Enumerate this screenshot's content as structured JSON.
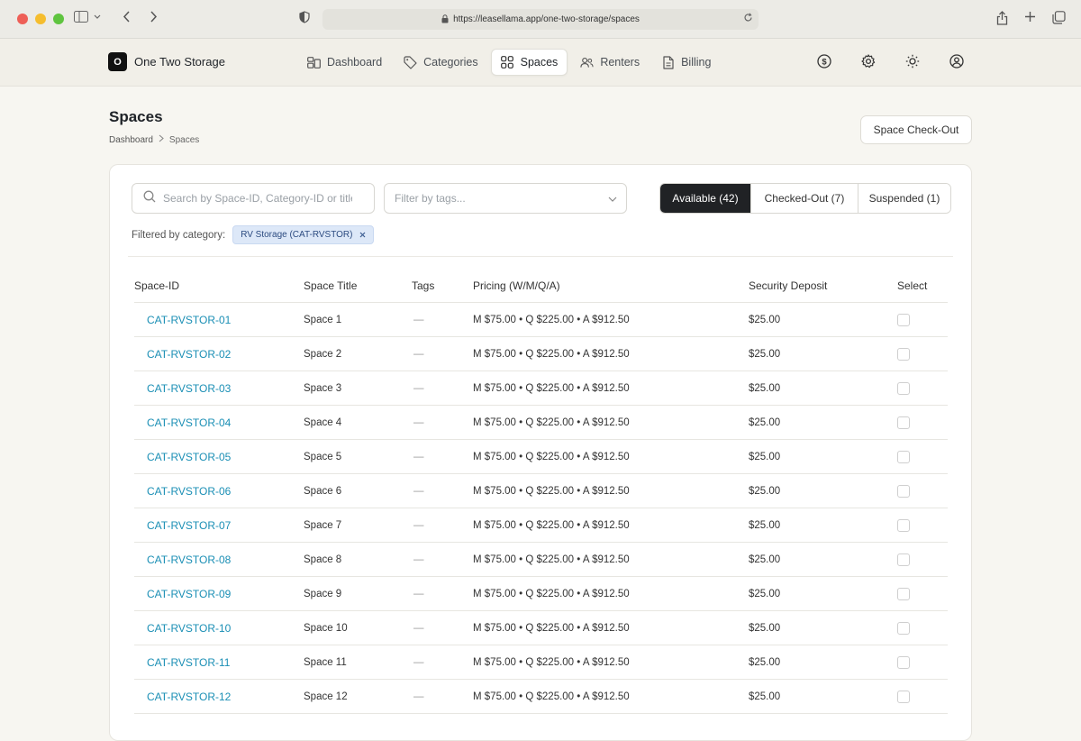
{
  "browser": {
    "url": "https://leasellama.app/one-two-storage/spaces"
  },
  "header": {
    "brand_logo": "O",
    "brand_name": "One Two Storage",
    "nav": [
      {
        "label": "Dashboard",
        "icon": "dashboard-icon",
        "active": false
      },
      {
        "label": "Categories",
        "icon": "tag-icon",
        "active": false
      },
      {
        "label": "Spaces",
        "icon": "grid-icon",
        "active": true
      },
      {
        "label": "Renters",
        "icon": "users-icon",
        "active": false
      },
      {
        "label": "Billing",
        "icon": "document-icon",
        "active": false
      }
    ],
    "right_icons": [
      "dollar-icon",
      "gear-icon",
      "sun-icon",
      "user-circle-icon"
    ]
  },
  "page": {
    "title": "Spaces",
    "breadcrumb": [
      "Dashboard",
      "Spaces"
    ],
    "checkout_label": "Space Check-Out"
  },
  "filters": {
    "search_placeholder": "Search by Space-ID, Category-ID or title",
    "tags_placeholder": "Filter by tags...",
    "segments": [
      {
        "label": "Available (42)",
        "active": true
      },
      {
        "label": "Checked-Out (7)",
        "active": false
      },
      {
        "label": "Suspended (1)",
        "active": false
      }
    ],
    "category_label": "Filtered by category:",
    "category_chip": "RV Storage (CAT-RVSTOR)"
  },
  "table": {
    "columns": [
      "Space-ID",
      "Space Title",
      "Tags",
      "Pricing (W/M/Q/A)",
      "Security Deposit",
      "Select"
    ],
    "rows": [
      {
        "id": "CAT-RVSTOR-01",
        "title": "Space 1",
        "tags": "—",
        "pricing": "M $75.00 • Q $225.00 • A $912.50",
        "deposit": "$25.00"
      },
      {
        "id": "CAT-RVSTOR-02",
        "title": "Space 2",
        "tags": "—",
        "pricing": "M $75.00 • Q $225.00 • A $912.50",
        "deposit": "$25.00"
      },
      {
        "id": "CAT-RVSTOR-03",
        "title": "Space 3",
        "tags": "—",
        "pricing": "M $75.00 • Q $225.00 • A $912.50",
        "deposit": "$25.00"
      },
      {
        "id": "CAT-RVSTOR-04",
        "title": "Space 4",
        "tags": "—",
        "pricing": "M $75.00 • Q $225.00 • A $912.50",
        "deposit": "$25.00"
      },
      {
        "id": "CAT-RVSTOR-05",
        "title": "Space 5",
        "tags": "—",
        "pricing": "M $75.00 • Q $225.00 • A $912.50",
        "deposit": "$25.00"
      },
      {
        "id": "CAT-RVSTOR-06",
        "title": "Space 6",
        "tags": "—",
        "pricing": "M $75.00 • Q $225.00 • A $912.50",
        "deposit": "$25.00"
      },
      {
        "id": "CAT-RVSTOR-07",
        "title": "Space 7",
        "tags": "—",
        "pricing": "M $75.00 • Q $225.00 • A $912.50",
        "deposit": "$25.00"
      },
      {
        "id": "CAT-RVSTOR-08",
        "title": "Space 8",
        "tags": "—",
        "pricing": "M $75.00 • Q $225.00 • A $912.50",
        "deposit": "$25.00"
      },
      {
        "id": "CAT-RVSTOR-09",
        "title": "Space 9",
        "tags": "—",
        "pricing": "M $75.00 • Q $225.00 • A $912.50",
        "deposit": "$25.00"
      },
      {
        "id": "CAT-RVSTOR-10",
        "title": "Space 10",
        "tags": "—",
        "pricing": "M $75.00 • Q $225.00 • A $912.50",
        "deposit": "$25.00"
      },
      {
        "id": "CAT-RVSTOR-11",
        "title": "Space 11",
        "tags": "—",
        "pricing": "M $75.00 • Q $225.00 • A $912.50",
        "deposit": "$25.00"
      },
      {
        "id": "CAT-RVSTOR-12",
        "title": "Space 12",
        "tags": "—",
        "pricing": "M $75.00 • Q $225.00 • A $912.50",
        "deposit": "$25.00"
      }
    ]
  }
}
